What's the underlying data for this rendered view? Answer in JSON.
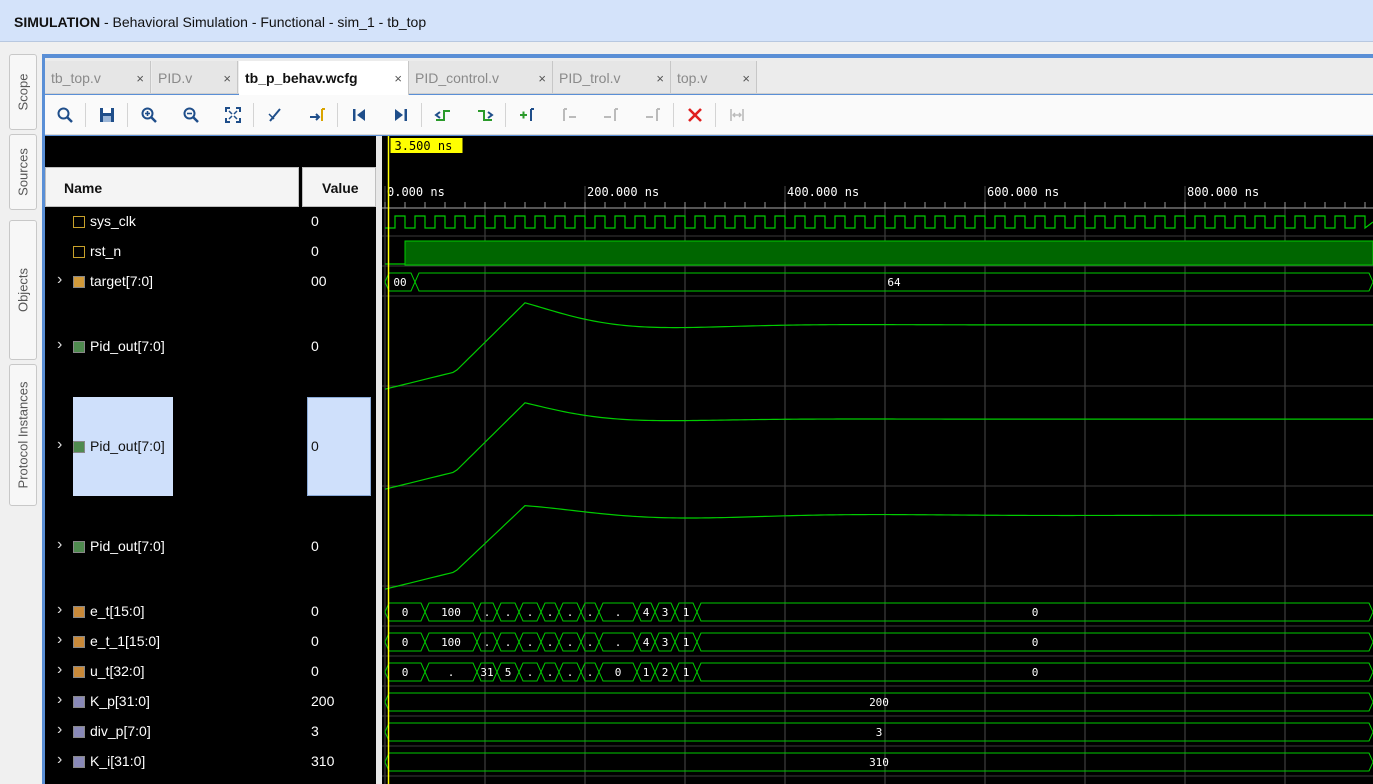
{
  "title": {
    "prefix": "SIMULATION",
    "rest": " - Behavioral Simulation - Functional - sim_1 - tb_top"
  },
  "side_tabs": [
    {
      "label": "Scope"
    },
    {
      "label": "Sources"
    },
    {
      "label": "Objects"
    },
    {
      "label": "Protocol Instances"
    }
  ],
  "tabs": [
    {
      "label": "tb_top.v",
      "active": false
    },
    {
      "label": "PID.v",
      "active": false
    },
    {
      "label": "tb_p_behav.wcfg",
      "active": true
    },
    {
      "label": "PID_control.v",
      "active": false
    },
    {
      "label": "PID_trol.v",
      "active": false
    },
    {
      "label": "top.v",
      "active": false
    }
  ],
  "tab_close": "×",
  "toolbar_icons": [
    "search-icon",
    "save-icon",
    "zoom-in-icon",
    "zoom-out-icon",
    "zoom-fit-icon",
    "cursor-icon",
    "go-to-marker-icon",
    "go-to-start-icon",
    "go-to-end-icon",
    "previous-transition-icon",
    "next-transition-icon",
    "add-marker-icon",
    "previous-marker-icon",
    "next-marker-icon",
    "remove-marker-icon",
    "delete-icon",
    "swap-cursors-icon"
  ],
  "headers": {
    "name": "Name",
    "value": "Value"
  },
  "cursor_label": "3.500 ns",
  "timeline": {
    "labels": [
      "0.000 ns",
      "200.000 ns",
      "400.000 ns",
      "600.000 ns",
      "800.000 ns"
    ],
    "tick_values_ns": [
      0,
      200,
      400,
      600,
      800
    ]
  },
  "signals": [
    {
      "name": "sys_clk",
      "value": "0",
      "expandable": false,
      "kind": "bit"
    },
    {
      "name": "rst_n",
      "value": "0",
      "expandable": false,
      "kind": "bit"
    },
    {
      "name": "target[7:0]",
      "value": "00",
      "expandable": true,
      "kind": "bus"
    },
    {
      "name": "Pid_out[7:0]",
      "value": "0",
      "expandable": true,
      "kind": "analog"
    },
    {
      "name": "Pid_out[7:0]",
      "value": "0",
      "expandable": true,
      "kind": "analog",
      "selected": true
    },
    {
      "name": "Pid_out[7:0]",
      "value": "0",
      "expandable": true,
      "kind": "analog"
    },
    {
      "name": "e_t[15:0]",
      "value": "0",
      "expandable": true,
      "kind": "bus"
    },
    {
      "name": "e_t_1[15:0]",
      "value": "0",
      "expandable": true,
      "kind": "bus"
    },
    {
      "name": "u_t[32:0]",
      "value": "0",
      "expandable": true,
      "kind": "bus"
    },
    {
      "name": "K_p[31:0]",
      "value": "200",
      "expandable": true,
      "kind": "bus"
    },
    {
      "name": "div_p[7:0]",
      "value": "3",
      "expandable": true,
      "kind": "bus"
    },
    {
      "name": "K_i[31:0]",
      "value": "310",
      "expandable": true,
      "kind": "bus"
    }
  ],
  "bus_values": {
    "target": [
      "00",
      "64"
    ],
    "e_t": [
      "0",
      "100",
      ".",
      ".",
      ".",
      ".",
      ".",
      ".",
      ".",
      "4",
      "3",
      "1",
      "0"
    ],
    "e_t_1": [
      "0",
      "100",
      ".",
      ".",
      ".",
      ".",
      ".",
      ".",
      ".",
      "4",
      "3",
      "1",
      "0"
    ],
    "u_t": [
      "0",
      ".",
      "31",
      "5",
      ".",
      ".",
      ".",
      ".",
      "0",
      "1",
      "2",
      "1",
      "0"
    ],
    "K_p": [
      "200"
    ],
    "div_p": [
      "3"
    ],
    "K_i": [
      "310"
    ]
  },
  "colors": {
    "wave": "#00cc00",
    "cursor": "#ffff00",
    "grid": "#4a4a4a",
    "selection": "#cfe0fb"
  }
}
